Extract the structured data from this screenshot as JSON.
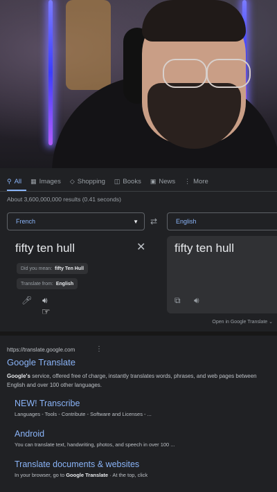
{
  "tabs": [
    {
      "label": "All",
      "icon": "search-icon"
    },
    {
      "label": "Images",
      "icon": "image-icon"
    },
    {
      "label": "Shopping",
      "icon": "tag-icon"
    },
    {
      "label": "Books",
      "icon": "book-icon"
    },
    {
      "label": "News",
      "icon": "news-icon"
    },
    {
      "label": "More",
      "icon": "more-vert-icon"
    }
  ],
  "results_count": "About 3,600,000,000 results (0.41 seconds)",
  "translator": {
    "source_lang": "French",
    "target_lang": "English",
    "source_text": "fifty ten hull",
    "target_text": "fifty ten hull",
    "did_you_mean_label": "Did you mean:",
    "did_you_mean_value": "fifty Ten Hull",
    "translate_from_label": "Translate from:",
    "translate_from_value": "English",
    "open_link": "Open in Google Translate"
  },
  "result": {
    "cite": "https://translate.google.com",
    "title": "Google Translate",
    "snippet_bold": "Google's",
    "snippet_rest": " service, offered free of charge, instantly translates words, phrases, and web pages between English and over 100 other languages.",
    "sitelinks": [
      {
        "title": "NEW! Transcribe",
        "desc": "Languages - Tools - Contribute - Software and Licenses - ..."
      },
      {
        "title": "Android",
        "desc": "You can translate text, handwriting, photos, and speech in over 100 ..."
      },
      {
        "title": "Translate documents & websites",
        "desc_pre": "In your browser, go to ",
        "desc_bold": "Google Translate",
        "desc_post": " · At the top, click"
      }
    ]
  },
  "colors": {
    "accent": "#8ab4f8",
    "background": "#202124"
  }
}
